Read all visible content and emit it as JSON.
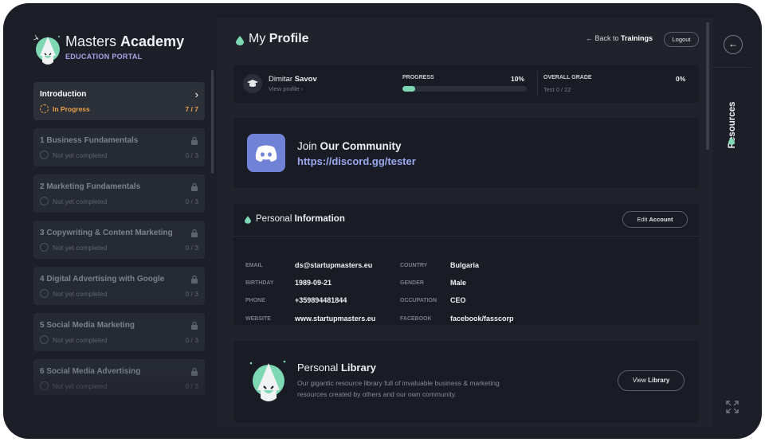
{
  "brand": {
    "title_light": "Masters",
    "title_bold": "Academy",
    "subtitle": "EDUCATION PORTAL"
  },
  "modules": [
    {
      "number": "",
      "title": "Introduction",
      "status": "In Progress",
      "count": "7 / 7",
      "state": "active"
    },
    {
      "number": "1",
      "title": "Business Fundamentals",
      "status": "Not yet completed",
      "count": "0 / 3",
      "state": "locked"
    },
    {
      "number": "2",
      "title": "Marketing Fundamentals",
      "status": "Not yet completed",
      "count": "0 / 3",
      "state": "locked"
    },
    {
      "number": "3",
      "title": "Copywriting & Content Marketing",
      "status": "Not yet completed",
      "count": "0 / 3",
      "state": "locked"
    },
    {
      "number": "4",
      "title": "Digital Advertising with Google",
      "status": "Not yet completed",
      "count": "0 / 3",
      "state": "locked"
    },
    {
      "number": "5",
      "title": "Social Media Marketing",
      "status": "Not yet completed",
      "count": "0 / 3",
      "state": "locked"
    },
    {
      "number": "6",
      "title": "Social Media Advertising",
      "status": "Not yet completed",
      "count": "0 / 3",
      "state": "locked"
    }
  ],
  "header": {
    "title_light": "My",
    "title_bold": "Profile",
    "back_text": "Back to",
    "back_bold": "Trainings",
    "logout": "Logout"
  },
  "progress": {
    "first_name": "Dimitar",
    "last_name": "Savov",
    "view_profile": "View profile",
    "progress_label": "PROGRESS",
    "progress_percent": "10%",
    "progress_value": 0.1,
    "grade_label": "OVERALL GRADE",
    "grade_percent": "0%",
    "test_text": "Test 0 / 22"
  },
  "community": {
    "join_light": "Join",
    "join_bold": "Our Community",
    "link": "https://discord.gg/tester"
  },
  "info": {
    "title_light": "Personal",
    "title_bold": "Information",
    "edit_light": "Edit",
    "edit_bold": "Account",
    "fields_left": [
      {
        "label": "EMAIL",
        "value": "ds@startupmasters.eu"
      },
      {
        "label": "BIRTHDAY",
        "value": "1989-09-21"
      },
      {
        "label": "PHONE",
        "value": "+359894481844"
      },
      {
        "label": "WEBSITE",
        "value": "www.startupmasters.eu"
      }
    ],
    "fields_right": [
      {
        "label": "COUNTRY",
        "value": "Bulgaria"
      },
      {
        "label": "GENDER",
        "value": "Male"
      },
      {
        "label": "OCCUPATION",
        "value": "CEO"
      },
      {
        "label": "FACEBOOK",
        "value": "facebook/fasscorp"
      }
    ]
  },
  "library": {
    "title_light": "Personal",
    "title_bold": "Library",
    "description": "Our gigantic resource library full of invaluable business & marketing resources created by others and our own community.",
    "view_light": "View",
    "view_bold": "Library"
  },
  "rail": {
    "label": "Resources",
    "back_icon": "arrow-left-icon",
    "expand_icon": "expand-icon"
  },
  "colors": {
    "accent_green": "#7fd8b4",
    "accent_orange": "#e9a24a",
    "discord": "#6f82d6",
    "link": "#9aa8f0"
  }
}
